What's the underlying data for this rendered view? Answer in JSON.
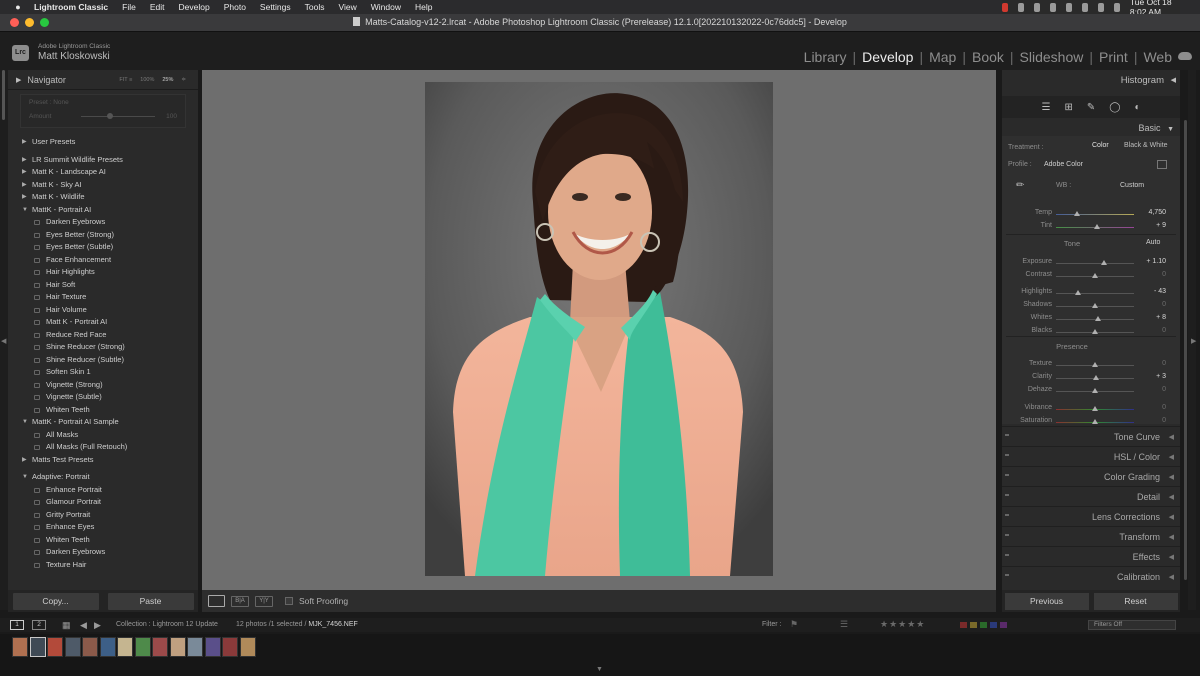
{
  "menubar": {
    "app": "Lightroom Classic",
    "items": [
      "File",
      "Edit",
      "Develop",
      "Photo",
      "Settings",
      "Tools",
      "View",
      "Window",
      "Help"
    ],
    "clock": "Tue Oct 18  8:02 AM"
  },
  "window": {
    "title": "Matts-Catalog-v12-2.lrcat - Adobe Photoshop Lightroom Classic (Prerelease) 12.1.0[202210132022-0c76ddc5] - Develop"
  },
  "identity": {
    "logo": "Lrc",
    "product": "Adobe Lightroom Classic",
    "user": "Matt Kloskowski"
  },
  "modules": [
    "Library",
    "Develop",
    "Map",
    "Book",
    "Slideshow",
    "Print",
    "Web"
  ],
  "active_module": "Develop",
  "navigator": {
    "title": "Navigator",
    "zoom": [
      "FIT ≡",
      "100%",
      "25%",
      "≑"
    ],
    "preset_label": "Preset : None",
    "amount_label": "Amount",
    "amount_value": "100"
  },
  "presets": [
    {
      "kind": "group",
      "label": "User Presets",
      "open": false
    },
    {
      "kind": "gap"
    },
    {
      "kind": "group",
      "label": "LR Summit Wildlife Presets",
      "open": false
    },
    {
      "kind": "group",
      "label": "Matt K - Landscape AI",
      "open": false
    },
    {
      "kind": "group",
      "label": "Matt K - Sky AI",
      "open": false
    },
    {
      "kind": "group",
      "label": "Matt K - Wildlife",
      "open": false
    },
    {
      "kind": "group",
      "label": "MattK - Portrait AI",
      "open": true
    },
    {
      "kind": "child",
      "label": "Darken Eyebrows"
    },
    {
      "kind": "child",
      "label": "Eyes Better (Strong)"
    },
    {
      "kind": "child",
      "label": "Eyes Better (Subtle)"
    },
    {
      "kind": "child",
      "label": "Face Enhancement"
    },
    {
      "kind": "child",
      "label": "Hair Highlights"
    },
    {
      "kind": "child",
      "label": "Hair Soft"
    },
    {
      "kind": "child",
      "label": "Hair Texture"
    },
    {
      "kind": "child",
      "label": "Hair Volume"
    },
    {
      "kind": "child",
      "label": "Matt K - Portrait AI"
    },
    {
      "kind": "child",
      "label": "Reduce Red Face"
    },
    {
      "kind": "child",
      "label": "Shine Reducer (Strong)"
    },
    {
      "kind": "child",
      "label": "Shine Reducer (Subtle)"
    },
    {
      "kind": "child",
      "label": "Soften Skin 1"
    },
    {
      "kind": "child",
      "label": "Vignette (Strong)"
    },
    {
      "kind": "child",
      "label": "Vignette (Subtle)"
    },
    {
      "kind": "child",
      "label": "Whiten Teeth"
    },
    {
      "kind": "group",
      "label": "MattK - Portrait AI Sample",
      "open": true
    },
    {
      "kind": "child",
      "label": "All Masks"
    },
    {
      "kind": "child",
      "label": "All Masks (Full Retouch)"
    },
    {
      "kind": "group",
      "label": "Matts Test Presets",
      "open": false
    },
    {
      "kind": "gap"
    },
    {
      "kind": "group",
      "label": "Adaptive: Portrait",
      "open": true
    },
    {
      "kind": "child",
      "label": "Enhance Portrait"
    },
    {
      "kind": "child",
      "label": "Glamour Portrait"
    },
    {
      "kind": "child",
      "label": "Gritty Portrait"
    },
    {
      "kind": "child",
      "label": "Enhance Eyes"
    },
    {
      "kind": "child",
      "label": "Whiten Teeth"
    },
    {
      "kind": "child",
      "label": "Darken Eyebrows"
    },
    {
      "kind": "child",
      "label": "Texture Hair"
    }
  ],
  "left_footer": {
    "copy": "Copy...",
    "paste": "Paste"
  },
  "toolbar": {
    "soft_proofing": "Soft Proofing",
    "ba_label": "B|A",
    "yy_label": "Y|Y"
  },
  "right": {
    "histogram": "Histogram",
    "basic": "Basic",
    "treatment_label": "Treatment :",
    "treatment_color": "Color",
    "treatment_bw": "Black & White",
    "profile_label": "Profile :",
    "profile_value": "Adobe Color",
    "wb_label": "WB :",
    "wb_value": "Custom",
    "tone_label": "Tone",
    "auto_label": "Auto",
    "presence_label": "Presence",
    "sliders": [
      {
        "label": "Temp",
        "value": "4,750",
        "pos": 0.27,
        "zero": false
      },
      {
        "label": "Tint",
        "value": "+ 9",
        "pos": 0.52,
        "zero": false
      },
      {
        "label": "Exposure",
        "value": "+ 1.10",
        "pos": 0.62,
        "zero": false
      },
      {
        "label": "Contrast",
        "value": "0",
        "pos": 0.5,
        "zero": true
      },
      {
        "label": "Highlights",
        "value": "- 43",
        "pos": 0.28,
        "zero": false
      },
      {
        "label": "Shadows",
        "value": "0",
        "pos": 0.5,
        "zero": true
      },
      {
        "label": "Whites",
        "value": "+ 8",
        "pos": 0.54,
        "zero": false
      },
      {
        "label": "Blacks",
        "value": "0",
        "pos": 0.5,
        "zero": true
      },
      {
        "label": "Texture",
        "value": "0",
        "pos": 0.5,
        "zero": true
      },
      {
        "label": "Clarity",
        "value": "+ 3",
        "pos": 0.51,
        "zero": false
      },
      {
        "label": "Dehaze",
        "value": "0",
        "pos": 0.5,
        "zero": true
      },
      {
        "label": "Vibrance",
        "value": "0",
        "pos": 0.5,
        "zero": true
      },
      {
        "label": "Saturation",
        "value": "0",
        "pos": 0.5,
        "zero": true
      }
    ],
    "panels": [
      "Tone Curve",
      "HSL / Color",
      "Color Grading",
      "Detail",
      "Lens Corrections",
      "Transform",
      "Effects",
      "Calibration"
    ],
    "previous": "Previous",
    "reset": "Reset"
  },
  "filmstrip": {
    "screen1": "1",
    "screen2": "2",
    "collection": "Collection : Lightroom 12 Update",
    "selection": "12 photos /1 selected /",
    "filename": "MJK_7456.NEF",
    "filter_label": "Filter :",
    "stars": "★★★★★",
    "filters_off": "Filters Off",
    "thumb_colors": [
      "#b07050",
      "#3f4a55",
      "#b34a3a",
      "#4e5a68",
      "#8b5a4a",
      "#3d5f87",
      "#c5b590",
      "#4e8a4a",
      "#9c4a4a",
      "#c0a080",
      "#7a8a99",
      "#5a4f8a",
      "#8a3a3a",
      "#b08a5a"
    ]
  }
}
